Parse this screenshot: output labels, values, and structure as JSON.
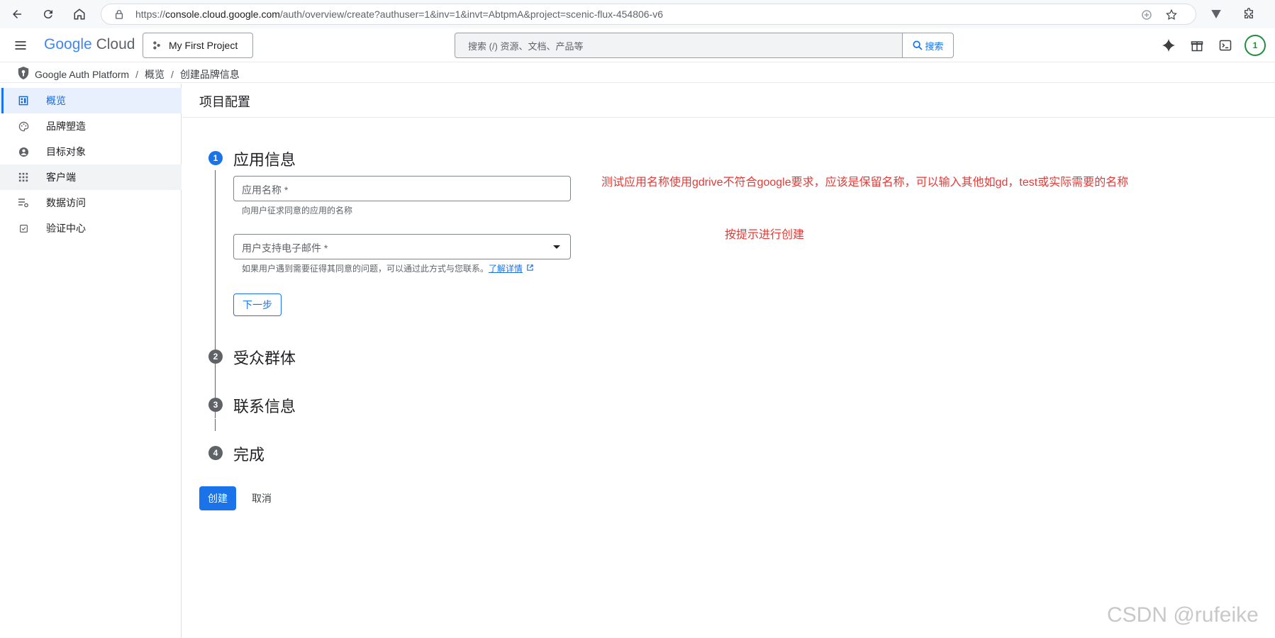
{
  "browser": {
    "url_prefix": "https://",
    "url_domain": "console.cloud.google.com",
    "url_path": "/auth/overview/create?authuser=1&inv=1&invt=AbtpmA&project=scenic-flux-454806-v6"
  },
  "header": {
    "logo_google": "Google",
    "logo_cloud": "Cloud",
    "project_name": "My First Project",
    "search_placeholder": "搜索 (/) 资源、文档、产品等",
    "search_button": "搜索",
    "avatar_text": "1"
  },
  "breadcrumb": {
    "items": [
      "Google Auth Platform",
      "概览",
      "创建品牌信息"
    ],
    "separator": "/"
  },
  "sidebar": {
    "items": [
      {
        "label": "概览",
        "icon": "dashboard-icon"
      },
      {
        "label": "品牌塑造",
        "icon": "palette-icon"
      },
      {
        "label": "目标对象",
        "icon": "person-icon"
      },
      {
        "label": "客户端",
        "icon": "apps-icon"
      },
      {
        "label": "数据访问",
        "icon": "data-access-icon"
      },
      {
        "label": "验证中心",
        "icon": "verified-icon"
      }
    ]
  },
  "main": {
    "page_title": "项目配置",
    "steps": [
      {
        "number": "1",
        "title": "应用信息"
      },
      {
        "number": "2",
        "title": "受众群体"
      },
      {
        "number": "3",
        "title": "联系信息"
      },
      {
        "number": "4",
        "title": "完成"
      }
    ],
    "app_name_field": {
      "label": "应用名称 *",
      "hint": "向用户征求同意的应用的名称"
    },
    "email_field": {
      "label": "用户支持电子邮件 *",
      "hint": "如果用户遇到需要征得其同意的问题，可以通过此方式与您联系。",
      "link": "了解详情"
    },
    "next_button": "下一步",
    "create_button": "创建",
    "cancel_button": "取消"
  },
  "annotations": {
    "note1": "测试应用名称使用gdrive不符合google要求，应该是保留名称，可以输入其他如gd，test或实际需要的名称",
    "note2": "按提示进行创建"
  },
  "watermark": "CSDN @rufeike",
  "colors": {
    "accent": "#1a73e8",
    "annotation": "#e53935",
    "active_bg": "#e8f0fe"
  }
}
